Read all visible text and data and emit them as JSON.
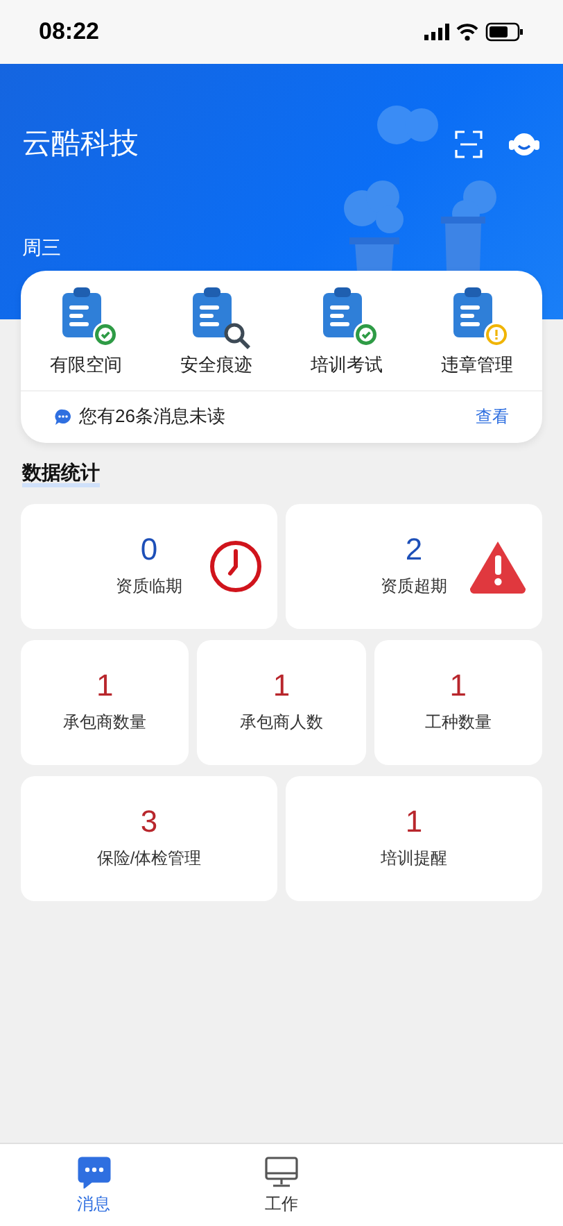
{
  "status_bar": {
    "time": "08:22"
  },
  "header": {
    "title": "云酷科技",
    "weekday": "周三"
  },
  "quick_actions": [
    {
      "label": "有限空间",
      "kind": "check"
    },
    {
      "label": "安全痕迹",
      "kind": "search"
    },
    {
      "label": "培训考试",
      "kind": "check"
    },
    {
      "label": "违章管理",
      "kind": "warning"
    }
  ],
  "notice": {
    "text": "您有26条消息未读",
    "link": "查看"
  },
  "section_title": "数据统计",
  "stat_rows": [
    [
      {
        "value": "0",
        "label": "资质临期",
        "color": "#1d4fb8",
        "kind": "clock"
      },
      {
        "value": "2",
        "label": "资质超期",
        "color": "#1d4fb8",
        "kind": "warning"
      }
    ],
    [
      {
        "value": "1",
        "label": "承包商数量",
        "color": "#b8262c"
      },
      {
        "value": "1",
        "label": "承包商人数",
        "color": "#b8262c"
      },
      {
        "value": "1",
        "label": "工种数量",
        "color": "#b8262c"
      }
    ],
    [
      {
        "value": "3",
        "label": "保险/体检管理",
        "color": "#b8262c"
      },
      {
        "value": "1",
        "label": "培训提醒",
        "color": "#b8262c"
      }
    ]
  ],
  "tab_bar": [
    {
      "label": "消息",
      "kind": "chat",
      "selected": true
    },
    {
      "label": "工作",
      "kind": "monitor",
      "selected": false
    }
  ]
}
